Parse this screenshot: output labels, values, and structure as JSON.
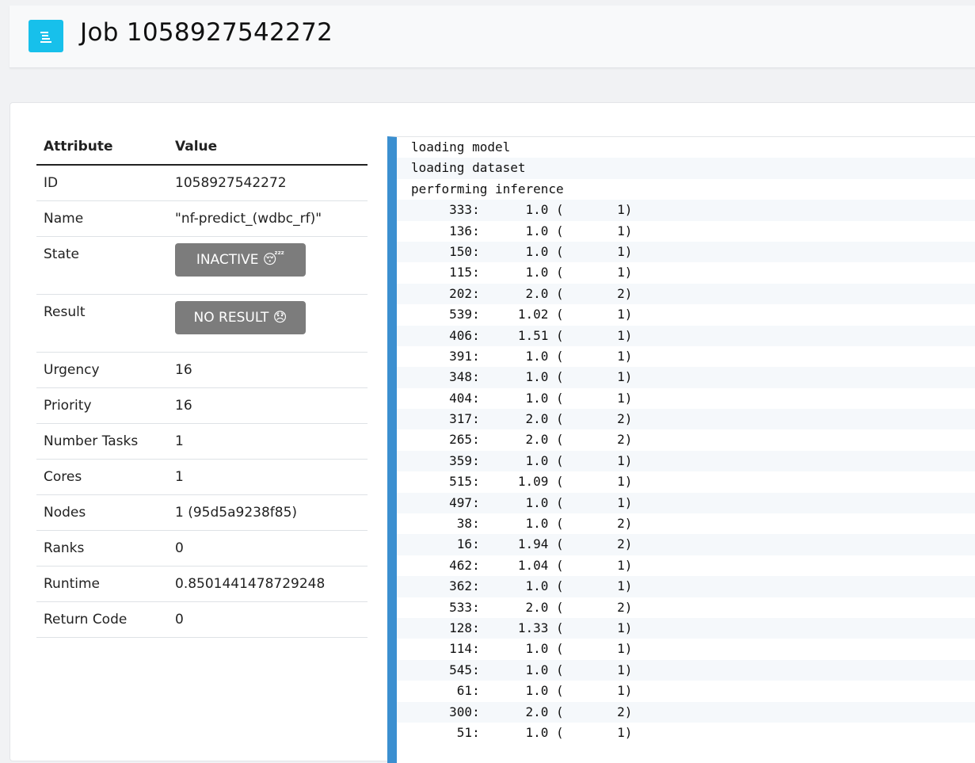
{
  "header": {
    "title": "Job 1058927542272",
    "menu_icon": "menu-icon",
    "menu_color": "#17c0eb"
  },
  "table": {
    "headers": [
      "Attribute",
      "Value"
    ],
    "rows": [
      {
        "label": "ID",
        "value": "1058927542272"
      },
      {
        "label": "Name",
        "value": "\"nf-predict_(wdbc_rf)\""
      },
      {
        "label": "State",
        "value": "INACTIVE 😴"
      },
      {
        "label": "Result",
        "value": "NO RESULT 😞"
      },
      {
        "label": "Urgency",
        "value": "16"
      },
      {
        "label": "Priority",
        "value": "16"
      },
      {
        "label": "Number Tasks",
        "value": "1"
      },
      {
        "label": "Cores",
        "value": "1"
      },
      {
        "label": "Nodes",
        "value": "1 (95d5a9238f85)"
      },
      {
        "label": "Ranks",
        "value": "0"
      },
      {
        "label": "Runtime",
        "value": "0.8501441478729248"
      },
      {
        "label": "Return Code",
        "value": "0"
      }
    ],
    "badge_color": "#7c7c7c"
  },
  "log": {
    "accent_color": "#3b8fd0",
    "lines": [
      "loading model",
      "loading dataset",
      "performing inference",
      "     333:      1.0 (       1)",
      "     136:      1.0 (       1)",
      "     150:      1.0 (       1)",
      "     115:      1.0 (       1)",
      "     202:      2.0 (       2)",
      "     539:     1.02 (       1)",
      "     406:     1.51 (       1)",
      "     391:      1.0 (       1)",
      "     348:      1.0 (       1)",
      "     404:      1.0 (       1)",
      "     317:      2.0 (       2)",
      "     265:      2.0 (       2)",
      "     359:      1.0 (       1)",
      "     515:     1.09 (       1)",
      "     497:      1.0 (       1)",
      "      38:      1.0 (       2)",
      "      16:     1.94 (       2)",
      "     462:     1.04 (       1)",
      "     362:      1.0 (       1)",
      "     533:      2.0 (       2)",
      "     128:     1.33 (       1)",
      "     114:      1.0 (       1)",
      "     545:      1.0 (       1)",
      "      61:      1.0 (       1)",
      "     300:      2.0 (       2)",
      "      51:      1.0 (       1)"
    ]
  }
}
